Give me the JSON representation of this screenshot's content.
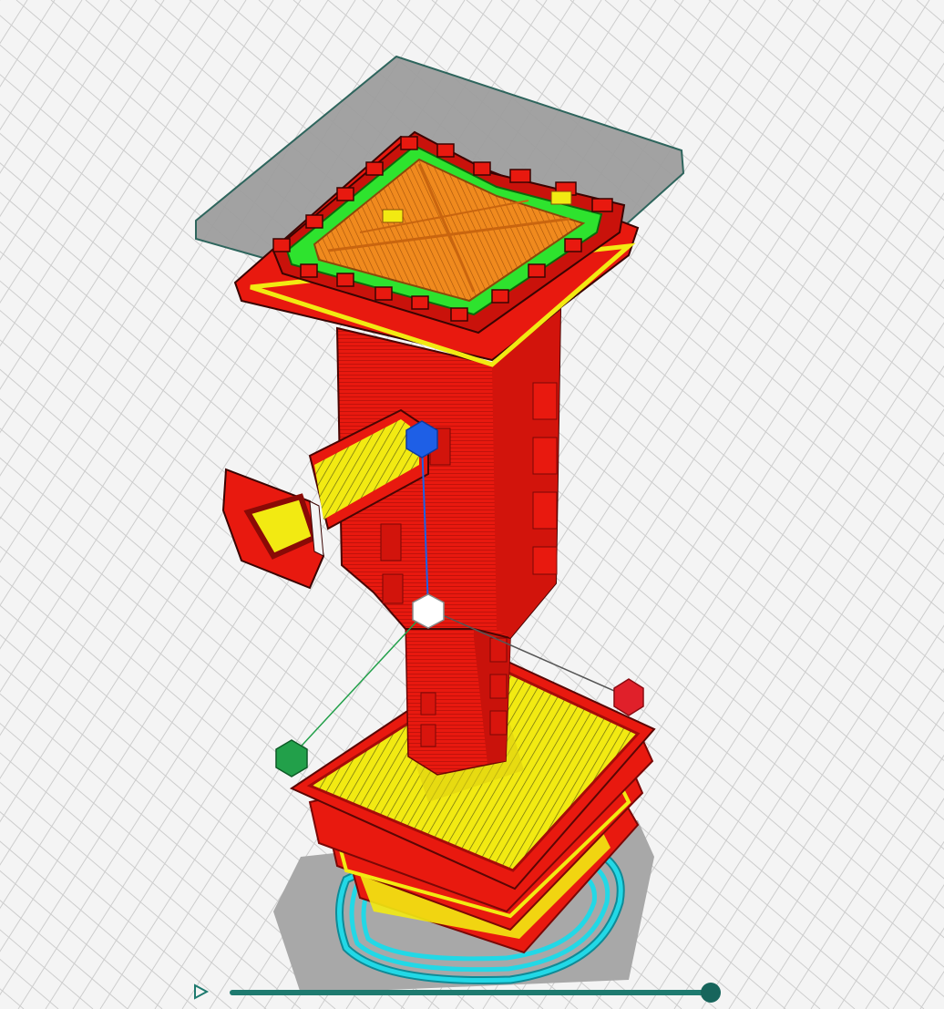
{
  "app": {
    "view": "layer-preview"
  },
  "colors": {
    "background": "#f4f4f4",
    "grid": "#c9c9c9",
    "build_plate_shadow": "#a4a4a4",
    "wall_outer": "#e8190f",
    "wall_dark": "#a50c08",
    "infill": "#f2ea12",
    "top_surface": "#f08a1e",
    "inner_wall": "#2ee32e",
    "skirt": "#22d8e6",
    "support_gray": "#9a9a9a",
    "gizmo_z": "#1e5fe6",
    "gizmo_x": "#e0202a",
    "gizmo_y": "#22a04a",
    "slider": "#1e7a6f"
  },
  "layer_slider": {
    "play_icon": "play-icon",
    "progress": 1.0
  },
  "gizmo": {
    "axis_z_icon": "blue-hexagon-handle",
    "axis_x_icon": "red-hexagon-handle",
    "axis_y_icon": "green-hexagon-handle",
    "center_icon": "white-cube-handle"
  }
}
